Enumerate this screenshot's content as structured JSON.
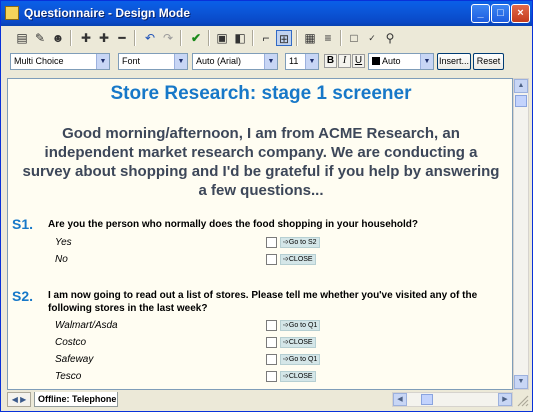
{
  "window": {
    "title": "Questionnaire - Design Mode",
    "controls": {
      "minimize": "_",
      "maximize": "□",
      "close": "×"
    }
  },
  "toolbar": {
    "icons": [
      "design-view-icon",
      "paint-icon",
      "people-icon",
      "add-icon",
      "add-branch-icon",
      "remove-icon",
      "undo-icon",
      "redo-icon",
      "check-icon",
      "properties-icon",
      "layout-icon",
      "tree-icon",
      "structure-icon",
      "table-icon",
      "sheets-icon",
      "preview-icon",
      "spellcheck-icon",
      "find-icon"
    ]
  },
  "format_bar": {
    "question_type": "Multi Choice",
    "font": "Font",
    "font_face": "Auto (Arial)",
    "font_size": "11",
    "bold": "B",
    "italic": "I",
    "underline": "U",
    "color": "Auto",
    "insert_label": "Insert...",
    "reset_label": "Reset"
  },
  "document": {
    "heading": "Store Research: stage 1 screener",
    "intro": "Good morning/afternoon, I am from ACME Research, an independent market research company. We are conducting a survey about shopping and I'd be grateful if you help by answering a few questions...",
    "questions": [
      {
        "number": "S1.",
        "text": "Are you the person who normally does the food shopping in your household?",
        "options": [
          {
            "label": "Yes",
            "route": "Go to S2"
          },
          {
            "label": "No",
            "route": "CLOSE"
          }
        ]
      },
      {
        "number": "S2.",
        "text": "I am now going to read out a list of stores. Please tell me whether you've visited any of the following stores in the last week?",
        "options": [
          {
            "label": "Walmart/Asda",
            "route": "Go to Q1"
          },
          {
            "label": "Costco",
            "route": "CLOSE"
          },
          {
            "label": "Safeway",
            "route": "Go to Q1"
          },
          {
            "label": "Tesco",
            "route": "CLOSE"
          }
        ]
      }
    ]
  },
  "tabs": {
    "active": "Offline: Telephone"
  },
  "colors": {
    "heading": "#1778c8",
    "intro": "#3d4759",
    "titlebar": "#0a5fe8",
    "route_bg": "#d4e6e8"
  }
}
